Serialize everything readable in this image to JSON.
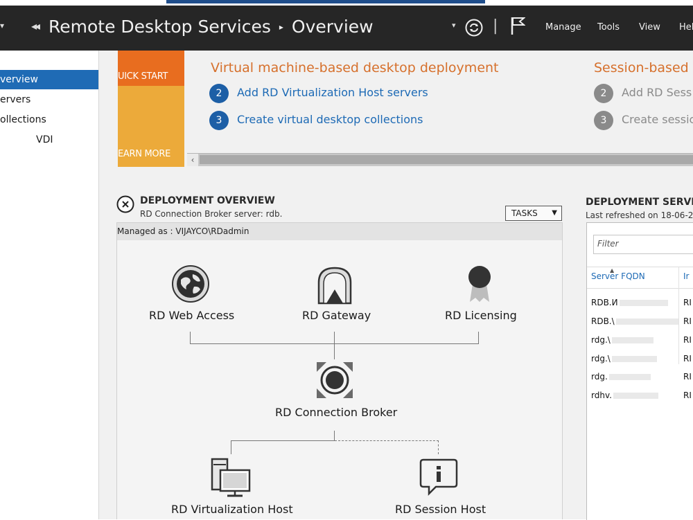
{
  "titlebar": {
    "back_glyph": "◂◂",
    "title_app": "Remote Desktop Services",
    "title_sep": "▸",
    "title_page": "Overview",
    "dropdown_glyph": "▾",
    "menu": [
      "Manage",
      "Tools",
      "View",
      "Hel"
    ]
  },
  "nav": {
    "items": [
      "verview",
      "ervers",
      "ollections",
      "VDI"
    ]
  },
  "quickstart": {
    "quick_start_label": "UICK START",
    "learn_more_label": "EARN MORE"
  },
  "vm_deployment": {
    "heading": "Virtual machine-based desktop deployment",
    "steps": [
      {
        "num": "2",
        "label": "Add RD Virtualization Host servers"
      },
      {
        "num": "3",
        "label": "Create virtual desktop collections"
      }
    ]
  },
  "session_deployment": {
    "heading": "Session-based c",
    "steps": [
      {
        "num": "2",
        "label": "Add RD Sess"
      },
      {
        "num": "3",
        "label": "Create sessic"
      }
    ]
  },
  "hscroll": {
    "left_glyph": "‹"
  },
  "deployment_overview": {
    "title": "DEPLOYMENT OVERVIEW",
    "subtitle": "RD Connection Broker server: rdb.",
    "tasks_label": "TASKS",
    "tasks_caret": "▼",
    "managed_as": "Managed as : VIJAYCO\\RDadmin",
    "roles": {
      "web_access": "RD Web Access",
      "gateway": "RD Gateway",
      "licensing": "RD Licensing",
      "connection_broker": "RD Connection Broker",
      "virtualization_host": "RD Virtualization Host",
      "session_host": "RD Session Host"
    }
  },
  "deployment_servers": {
    "title": "DEPLOYMENT SERVE",
    "subtitle": "Last refreshed on 18-06-2",
    "filter_placeholder": "Filter",
    "col_fqdn": "Server FQDN",
    "col_role": "Ir",
    "rows": [
      {
        "name": "RDB.И",
        "role": "RI"
      },
      {
        "name": "RDB.\\",
        "role": "RI"
      },
      {
        "name": "rdg.\\",
        "role": "RI"
      },
      {
        "name": "rdg.\\",
        "role": "RI"
      },
      {
        "name": "rdg.",
        "role": "RI"
      },
      {
        "name": "rdhv.",
        "role": "RI"
      }
    ]
  }
}
